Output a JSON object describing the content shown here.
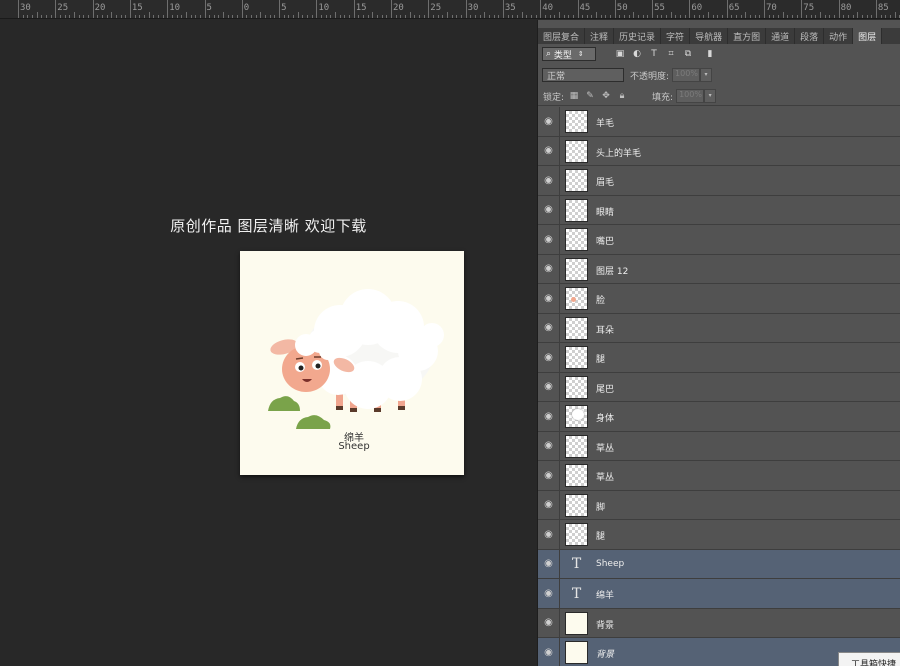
{
  "ruler": {
    "labels": [
      "30",
      "25",
      "20",
      "15",
      "10",
      "5",
      "0",
      "5",
      "10",
      "15",
      "20",
      "25",
      "30",
      "35",
      "40",
      "45",
      "50",
      "55",
      "60",
      "65",
      "70",
      "75",
      "80",
      "85"
    ]
  },
  "canvas": {
    "caption": "原创作品 图层清晰 欢迎下载",
    "artwork": {
      "label_cn": "绵羊",
      "label_en": "Sheep",
      "background_color": "#fdfbee"
    }
  },
  "panel": {
    "tabs": [
      "图层复合",
      "注释",
      "历史记录",
      "字符",
      "导航器",
      "直方图",
      "通道",
      "段落",
      "动作",
      "图层"
    ],
    "active_tab": "图层",
    "filter_label": "类型",
    "filter_icons": [
      "image-filter-icon",
      "adjustment-filter-icon",
      "type-filter-icon",
      "shape-filter-icon",
      "smart-object-filter-icon",
      "filter-toggle-icon"
    ],
    "blend_mode": "正常",
    "opacity_label": "不透明度:",
    "opacity_value": "100%",
    "lock_label": "锁定:",
    "fill_label": "填充:",
    "fill_value": "100%",
    "layers": [
      {
        "name": "羊毛",
        "kind": "pixel"
      },
      {
        "name": "头上的羊毛",
        "kind": "pixel"
      },
      {
        "name": "眉毛",
        "kind": "pixel"
      },
      {
        "name": "眼睛",
        "kind": "pixel"
      },
      {
        "name": "嘴巴",
        "kind": "pixel"
      },
      {
        "name": "图层 12",
        "kind": "pixel"
      },
      {
        "name": "脸",
        "kind": "pixel"
      },
      {
        "name": "耳朵",
        "kind": "pixel"
      },
      {
        "name": "腿",
        "kind": "pixel"
      },
      {
        "name": "尾巴",
        "kind": "pixel"
      },
      {
        "name": "身体",
        "kind": "pixel"
      },
      {
        "name": "草丛",
        "kind": "pixel"
      },
      {
        "name": "草丛",
        "kind": "pixel"
      },
      {
        "name": "脚",
        "kind": "pixel"
      },
      {
        "name": "腿",
        "kind": "pixel"
      },
      {
        "name": "Sheep",
        "kind": "text"
      },
      {
        "name": "绵羊",
        "kind": "text"
      },
      {
        "name": "背景",
        "kind": "solid"
      },
      {
        "name": "背景",
        "kind": "solid"
      }
    ],
    "tooltip": "工具箱快捷"
  }
}
